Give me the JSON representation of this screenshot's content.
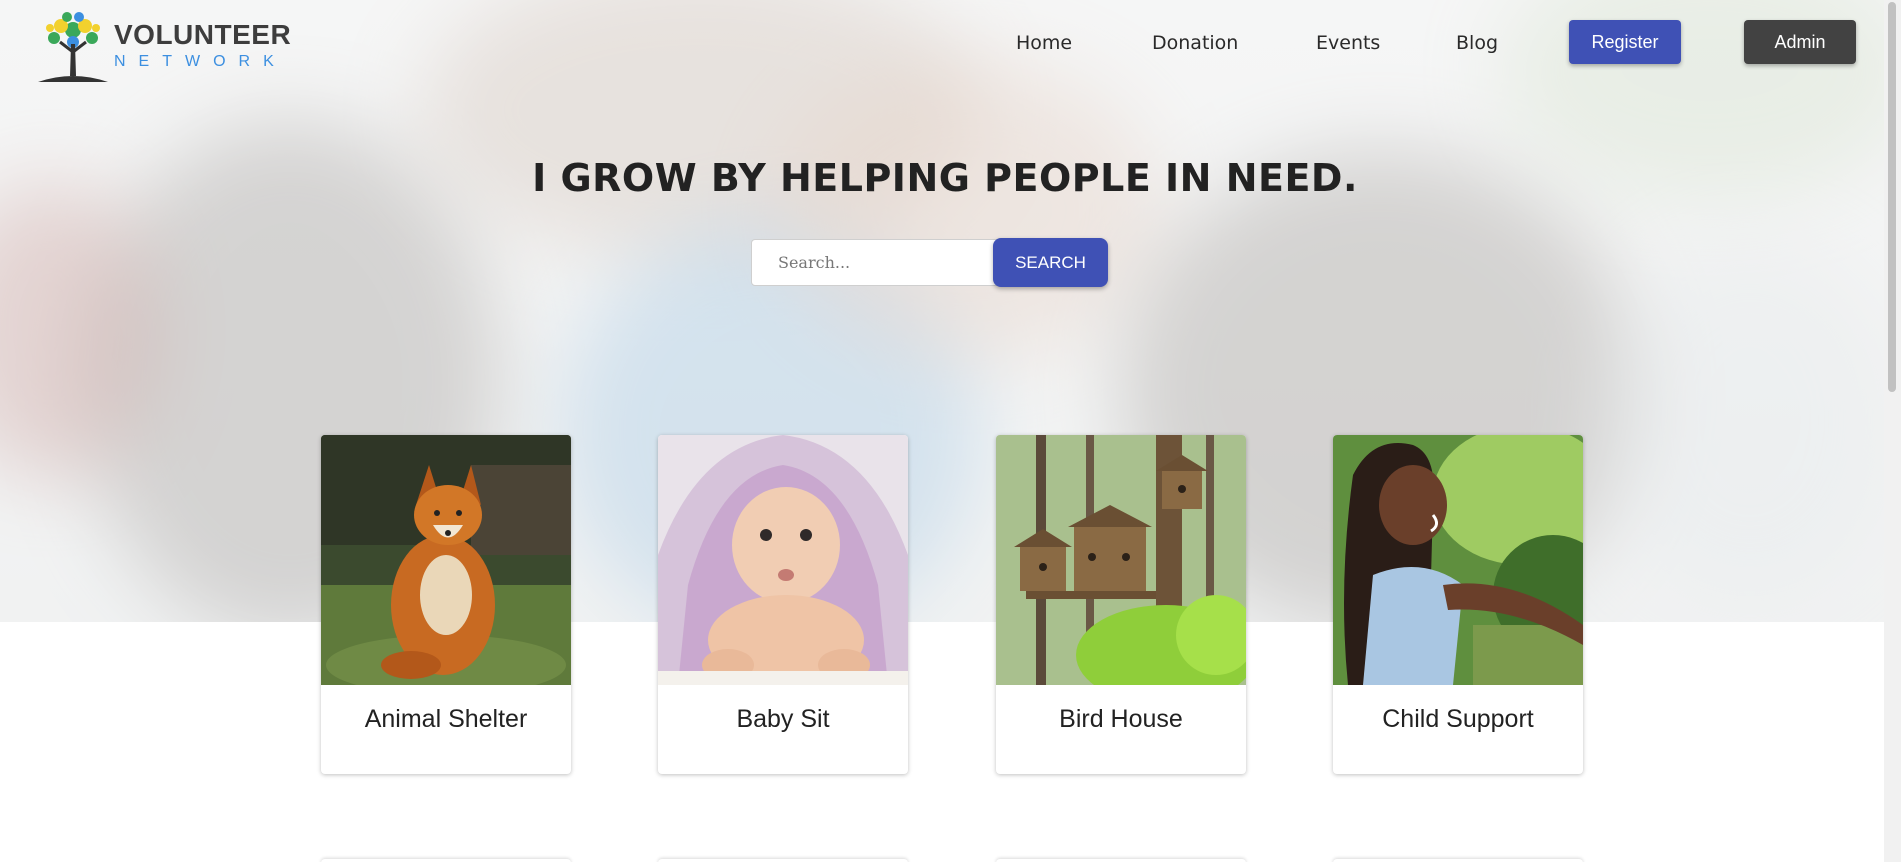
{
  "logo": {
    "title": "VOLUNTEER",
    "subtitle": "NETWORK",
    "icon": "tree-logo-icon"
  },
  "nav": {
    "links": [
      "Home",
      "Donation",
      "Events",
      "Blog"
    ],
    "register_label": "Register",
    "admin_label": "Admin"
  },
  "hero": {
    "title": "I GROW BY HELPING PEOPLE IN NEED.",
    "search_placeholder": "Search...",
    "search_button": "SEARCH"
  },
  "cards": [
    {
      "label": "Animal Shelter",
      "image": "fox-photo"
    },
    {
      "label": "Baby Sit",
      "image": "baby-photo"
    },
    {
      "label": "Bird House",
      "image": "birdhouse-photo"
    },
    {
      "label": "Child Support",
      "image": "girl-photo"
    }
  ],
  "colors": {
    "primary": "#3f51b5",
    "admin": "#424242",
    "logo_blue": "#3c8fe0"
  }
}
